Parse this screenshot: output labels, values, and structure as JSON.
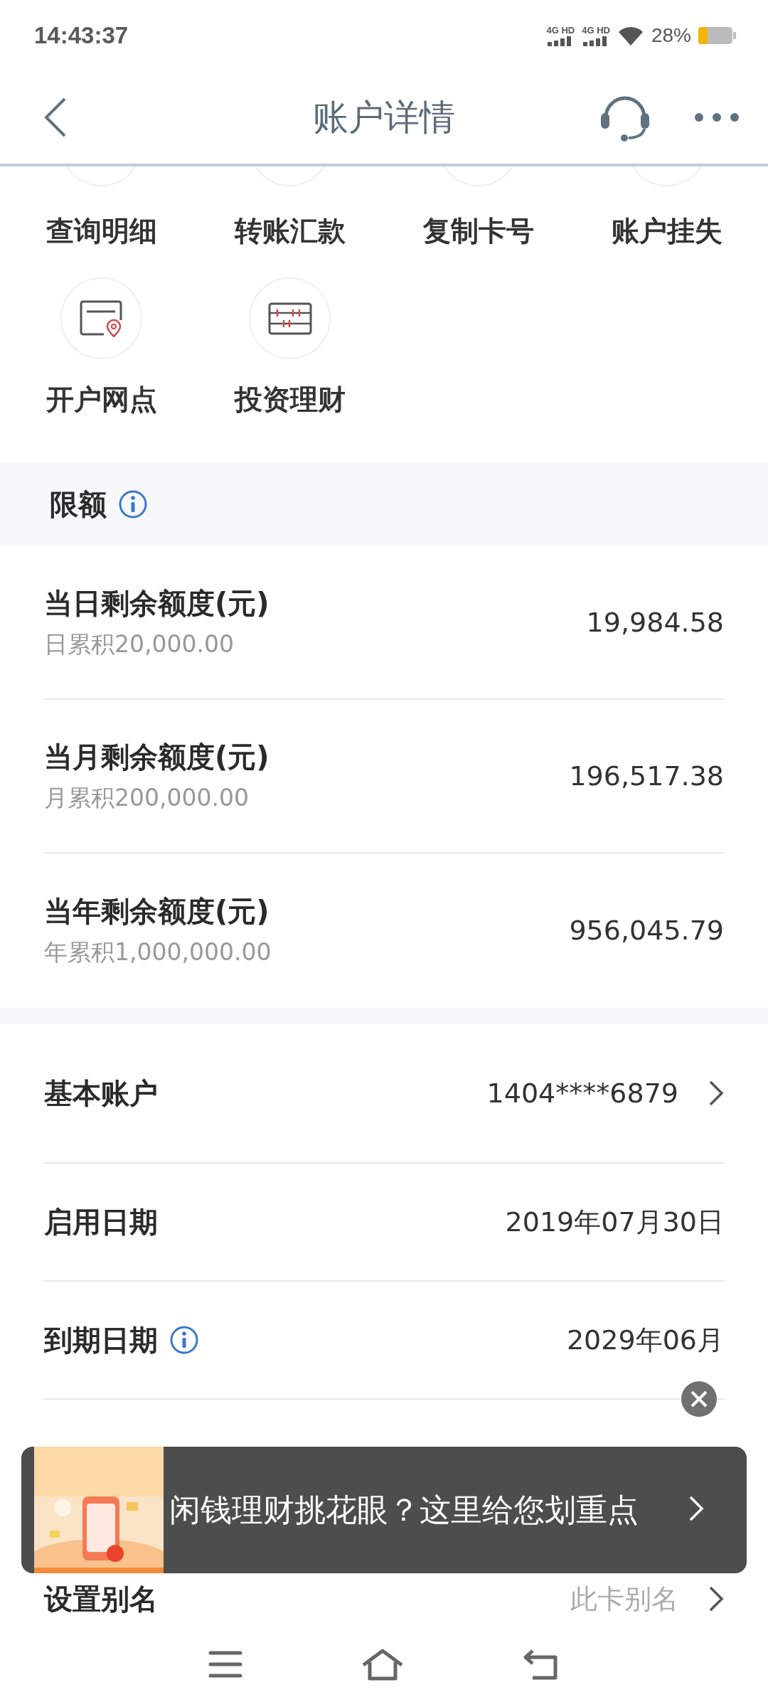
{
  "status_bar": {
    "time": "14:43:37",
    "sim_1": "4G HD",
    "sim_2": "4G HD",
    "battery": "28%"
  },
  "header": {
    "title": "账户详情"
  },
  "actions_row_1": [
    {
      "label": "查询明细"
    },
    {
      "label": "转账汇款"
    },
    {
      "label": "复制卡号"
    },
    {
      "label": "账户挂失"
    }
  ],
  "actions_row_2": [
    {
      "label": "开户网点",
      "kind": "branch"
    },
    {
      "label": "投资理财",
      "kind": "abacus"
    }
  ],
  "limits": {
    "title": "限额",
    "rows": [
      {
        "label": "当日剩余额度(元)",
        "cumulative": "日累积20,000.00",
        "value": "19,984.58"
      },
      {
        "label": "当月剩余额度(元)",
        "cumulative": "月累积200,000.00",
        "value": "196,517.38"
      },
      {
        "label": "当年剩余额度(元)",
        "cumulative": "年累积1,000,000.00",
        "value": "956,045.79"
      }
    ]
  },
  "details": [
    {
      "label": "基本账户",
      "value": "1404****6879",
      "info": false,
      "chevron": true,
      "muted": false
    },
    {
      "label": "启用日期",
      "value": "2019年07月30日",
      "info": false,
      "chevron": false,
      "muted": false
    },
    {
      "label": "到期日期",
      "value": "2029年06月",
      "info": true,
      "chevron": false,
      "muted": false
    }
  ],
  "last_row": {
    "label": "设置别名",
    "value": "此卡别名",
    "info": false,
    "chevron": true,
    "muted": true
  },
  "ad": {
    "text": "闲钱理财挑花眼？这里给您划重点"
  }
}
